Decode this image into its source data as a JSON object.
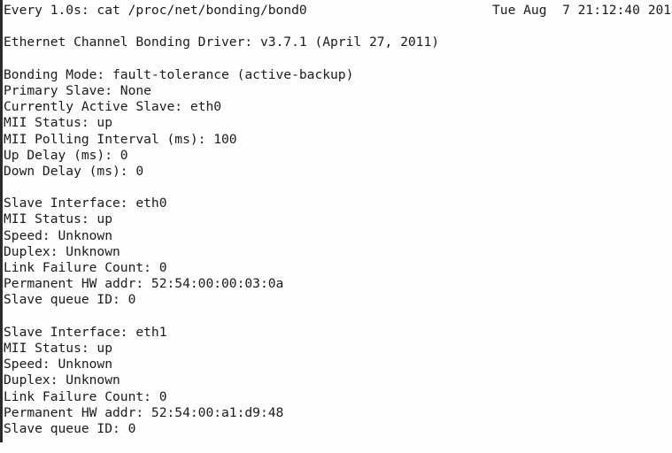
{
  "terminal": {
    "background_color": "#fefefe",
    "text_color": "#1a1a1a",
    "edge_bar_color": "#2b2b2b",
    "watch_header": {
      "command": "Every 1.0s: cat /proc/net/bonding/bond0",
      "interval": "1.0s",
      "watched_command": "cat /proc/net/bonding/bond0",
      "timestamp": "Tue Aug  7 21:12:40 201"
    },
    "lines": [
      "Ethernet Channel Bonding Driver: v3.7.1 (April 27, 2011)",
      "",
      "Bonding Mode: fault-tolerance (active-backup)",
      "Primary Slave: None",
      "Currently Active Slave: eth0",
      "MII Status: up",
      "MII Polling Interval (ms): 100",
      "Up Delay (ms): 0",
      "Down Delay (ms): 0",
      "",
      "Slave Interface: eth0",
      "MII Status: up",
      "Speed: Unknown",
      "Duplex: Unknown",
      "Link Failure Count: 0",
      "Permanent HW addr: 52:54:00:00:03:0a",
      "Slave queue ID: 0",
      "",
      "Slave Interface: eth1",
      "MII Status: up",
      "Speed: Unknown",
      "Duplex: Unknown",
      "Link Failure Count: 0",
      "Permanent HW addr: 52:54:00:a1:d9:48",
      "Slave queue ID: 0"
    ],
    "bonding": {
      "driver": "Ethernet Channel Bonding Driver",
      "driver_version": "v3.7.1",
      "driver_date": "April 27, 2011",
      "mode": "fault-tolerance (active-backup)",
      "primary_slave": "None",
      "currently_active_slave": "eth0",
      "mii_status": "up",
      "mii_polling_interval_ms": "100",
      "up_delay_ms": "0",
      "down_delay_ms": "0",
      "slaves": [
        {
          "interface": "eth0",
          "mii_status": "up",
          "speed": "Unknown",
          "duplex": "Unknown",
          "link_failure_count": "0",
          "permanent_hw_addr": "52:54:00:00:03:0a",
          "slave_queue_id": "0"
        },
        {
          "interface": "eth1",
          "mii_status": "up",
          "speed": "Unknown",
          "duplex": "Unknown",
          "link_failure_count": "0",
          "permanent_hw_addr": "52:54:00:a1:d9:48",
          "slave_queue_id": "0"
        }
      ]
    }
  }
}
